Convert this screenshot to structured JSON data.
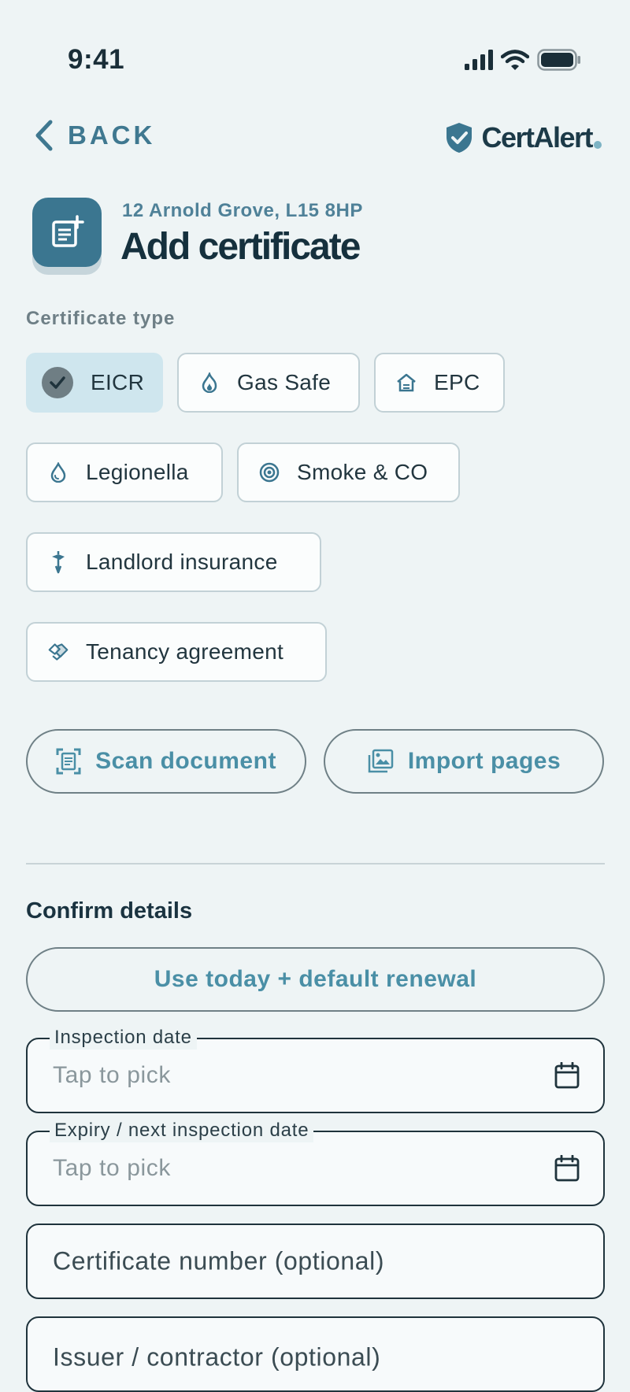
{
  "status_bar": {
    "time": "9:41"
  },
  "header": {
    "back_label": "BACK",
    "brand_name": "CertAlert"
  },
  "title": {
    "address": "12 Arnold Grove, L15 8HP",
    "heading": "Add certificate"
  },
  "certificate_type": {
    "label": "Certificate type",
    "selected": "EICR",
    "options": [
      {
        "label": "EICR",
        "icon": "check-icon"
      },
      {
        "label": "Gas Safe",
        "icon": "flame-icon"
      },
      {
        "label": "EPC",
        "icon": "house-icon"
      },
      {
        "label": "Legionella",
        "icon": "droplet-icon"
      },
      {
        "label": "Smoke & CO",
        "icon": "alarm-icon"
      },
      {
        "label": "Landlord insurance",
        "icon": "umbrella-icon"
      },
      {
        "label": "Tenancy agreement",
        "icon": "handshake-icon"
      }
    ]
  },
  "actions": {
    "scan_label": "Scan document",
    "import_label": "Import pages"
  },
  "confirm": {
    "heading": "Confirm details",
    "default_button": "Use today + default renewal",
    "inspection_label": "Inspection date",
    "inspection_placeholder": "Tap to pick",
    "expiry_label": "Expiry / next inspection date",
    "expiry_placeholder": "Tap to pick",
    "certificate_number_placeholder": "Certificate number (optional)",
    "issuer_placeholder": "Issuer / contractor (optional)"
  },
  "colors": {
    "accent": "#3b7690",
    "selected_chip": "#cfe6ee",
    "background": "#eef4f5"
  }
}
